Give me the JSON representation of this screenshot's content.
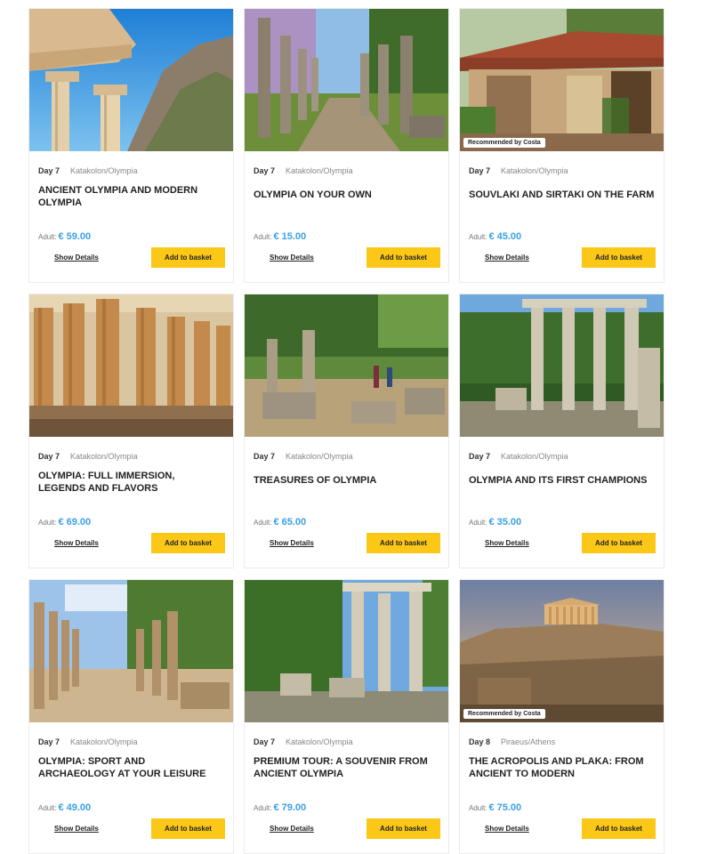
{
  "recommended_label": "Recommended by Costa",
  "adult_label": "Adult:",
  "show_details_label": "Show Details",
  "add_basket_label": "Add to basket",
  "tours": [
    {
      "day": "Day 7",
      "location": "Katakolon/Olympia",
      "title": "ANCIENT OLYMPIA AND MODERN OLYMPIA",
      "price": "€ 59.00",
      "recommended": false,
      "image": "temple-cliff"
    },
    {
      "day": "Day 7",
      "location": "Katakolon/Olympia",
      "title": "OLYMPIA ON YOUR OWN",
      "price": "€ 15.00",
      "recommended": false,
      "image": "column-path"
    },
    {
      "day": "Day 7",
      "location": "Katakolon/Olympia",
      "title": "SOUVLAKI AND SIRTAKI ON THE FARM",
      "price": "€ 45.00",
      "recommended": true,
      "image": "farm-house"
    },
    {
      "day": "Day 7",
      "location": "Katakolon/Olympia",
      "title": "OLYMPIA: FULL IMMERSION, LEGENDS AND FLAVORS",
      "price": "€ 69.00",
      "recommended": false,
      "image": "doric-temple"
    },
    {
      "day": "Day 7",
      "location": "Katakolon/Olympia",
      "title": "TREASURES OF OLYMPIA",
      "price": "€ 65.00",
      "recommended": false,
      "image": "ruins-trees"
    },
    {
      "day": "Day 7",
      "location": "Katakolon/Olympia",
      "title": "OLYMPIA AND ITS FIRST CHAMPIONS",
      "price": "€ 35.00",
      "recommended": false,
      "image": "columns-forest"
    },
    {
      "day": "Day 7",
      "location": "Katakolon/Olympia",
      "title": "OLYMPIA: SPORT AND ARCHAEOLOGY AT YOUR LEISURE",
      "price": "€ 49.00",
      "recommended": false,
      "image": "colonnade"
    },
    {
      "day": "Day 7",
      "location": "Katakolon/Olympia",
      "title": "PREMIUM TOUR: A SOUVENIR FROM ANCIENT OLYMPIA",
      "price": "€ 79.00",
      "recommended": false,
      "image": "columns-forest-2"
    },
    {
      "day": "Day 8",
      "location": "Piraeus/Athens",
      "title": "THE ACROPOLIS AND PLAKA: FROM ANCIENT TO MODERN",
      "price": "€ 75.00",
      "recommended": true,
      "image": "acropolis"
    }
  ]
}
